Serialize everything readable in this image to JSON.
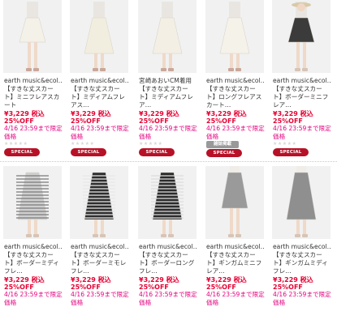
{
  "rows": [
    {
      "products": [
        {
          "brand": "earth music&ecol…",
          "name": "【すきな丈スカート】ミニフレアスカート",
          "price": "¥3,229 税込",
          "discount": "25%OFF",
          "deadline": "4/16 23:59まで限定価格",
          "stars": "★★★★★",
          "badge": "SPECIAL PRICE",
          "skirt_color": "#f4f1e8",
          "model": "boots"
        },
        {
          "brand": "earth music&ecol…",
          "name": "【すきな丈スカート】ミディアムフレアス…",
          "price": "¥3,229 税込",
          "discount": "25%OFF",
          "deadline": "4/16 23:59まで限定価格",
          "stars": "★★★★★",
          "badge": "SPECIAL PRICE",
          "skirt_color": "#f2eedf",
          "model": "boots"
        },
        {
          "brand": "宮崎あおいCM着用",
          "name": "【すきな丈スカート】ミディアムフレア…",
          "price": "¥3,229 税込",
          "discount": "25%OFF",
          "deadline": "4/16 23:59まで限定価格",
          "stars": "★★★★★",
          "badge": "SPECIAL PRICE",
          "skirt_color": "#f3efe4",
          "model": "boots"
        },
        {
          "brand": "earth music&ecol…",
          "name": "【すきな丈スカート】ロングフレアスカート…",
          "price": "¥3,229 税込",
          "discount": "25%OFF",
          "deadline": "4/16 23:59まで限定価格",
          "stars": "★★★★★",
          "badge_extra": "雑誌掲載",
          "badge": "SPECIAL PRICE",
          "skirt_color": "#f5f2ea",
          "model": "boots"
        },
        {
          "brand": "earth music&ecol…",
          "name": "【すきな丈スカート】ボーダーミニフレア…",
          "price": "¥3,229 税込",
          "discount": "25%OFF",
          "deadline": "4/16 23:59まで限定価格",
          "stars": "★★★★★",
          "badge": "SPECIAL PRICE",
          "skirt_color": "#3b3b3b",
          "model": "hat"
        }
      ]
    },
    {
      "products": [
        {
          "brand": "earth music&ecol…",
          "name": "【すきな丈スカート】ボーダーミディフレ…",
          "price": "¥3,229 税込",
          "discount": "25%OFF",
          "deadline": "4/16 23:59まで限定価格",
          "skirt_color": "#cfcfcf",
          "stripes": "#7a7a7a",
          "model": "plain"
        },
        {
          "brand": "earth music&ecol…",
          "name": "【すきな丈スカート】ボーダーミモレフレ…",
          "price": "¥3,229 税込",
          "discount": "25%OFF",
          "deadline": "4/16 23:59まで限定価格",
          "skirt_color": "#2e2e2e",
          "stripes": "#e8e8e8",
          "model": "plain"
        },
        {
          "brand": "earth music&ecol…",
          "name": "【すきな丈スカート】ボーダーロングフレ…",
          "price": "¥3,229 税込",
          "discount": "25%OFF",
          "deadline": "4/16 23:59まで限定価格",
          "skirt_color": "#2b2b2b",
          "stripes": "#dcdcdc",
          "model": "plain"
        },
        {
          "brand": "earth music&ecol…",
          "name": "【すきな丈スカート】ギンガムミニフレア…",
          "price": "¥3,229 税込",
          "discount": "25%OFF",
          "deadline": "4/16 23:59まで限定価格",
          "skirt_color": "#9a9a9a",
          "model": "legs"
        },
        {
          "brand": "earth music&ecol…",
          "name": "【すきな丈スカート】ギンガムミディフレ…",
          "price": "¥3,229 税込",
          "discount": "25%OFF",
          "deadline": "4/16 23:59まで限定価格",
          "skirt_color": "#8f8f8f",
          "model": "hat"
        }
      ]
    }
  ]
}
